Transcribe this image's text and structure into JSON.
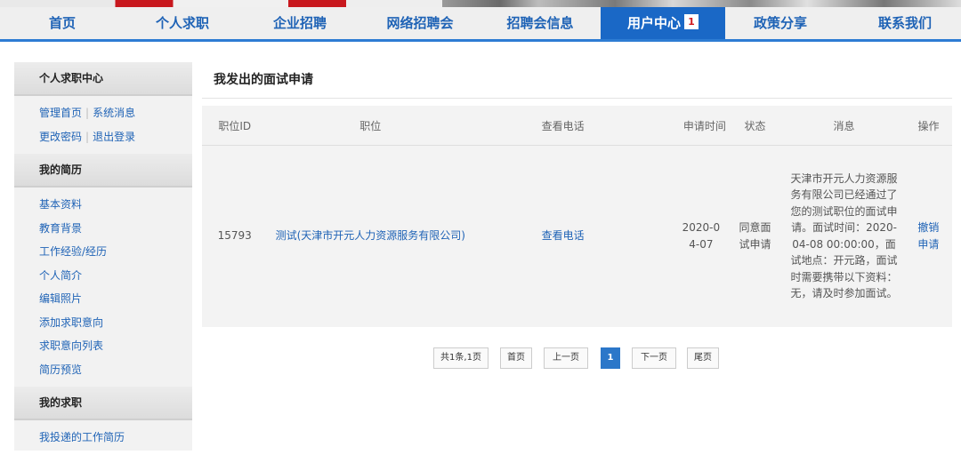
{
  "nav": {
    "items": [
      "首页",
      "个人求职",
      "企业招聘",
      "网络招聘会",
      "招聘会信息",
      "用户中心",
      "政策分享",
      "联系我们"
    ],
    "badge": "1"
  },
  "sidebar": {
    "title_center": "个人求职中心",
    "links_top": [
      [
        "管理首页",
        "系统消息"
      ],
      [
        "更改密码",
        "退出登录"
      ]
    ],
    "resume_title": "我的简历",
    "resume_links": [
      "基本资料",
      "教育背景",
      "工作经验/经历",
      "个人简介",
      "编辑照片",
      "添加求职意向",
      "求职意向列表",
      "简历预览"
    ],
    "job_title": "我的求职",
    "job_links": [
      "我投递的工作简历"
    ]
  },
  "main": {
    "title": "我发出的面试申请",
    "columns": [
      "职位ID",
      "职位",
      "查看电话",
      "申请时间",
      "状态",
      "消息",
      "操作"
    ],
    "rows": [
      {
        "id": "15793",
        "position": "测试(天津市开元人力资源服务有限公司)",
        "phone": "查看电话",
        "time": "2020-04-07",
        "status": "同意面试申请",
        "message": "天津市开元人力资源服务有限公司已经通过了您的测试职位的面试申请。面试时间：2020-04-08 00:00:00，面试地点：开元路，面试时需要携带以下资料：无，请及时参加面试。",
        "action": "撤销申请"
      }
    ]
  },
  "pager": {
    "summary": "共1条,1页",
    "first": "首页",
    "prev": "上一页",
    "current": "1",
    "next": "下一页",
    "last": "尾页"
  }
}
